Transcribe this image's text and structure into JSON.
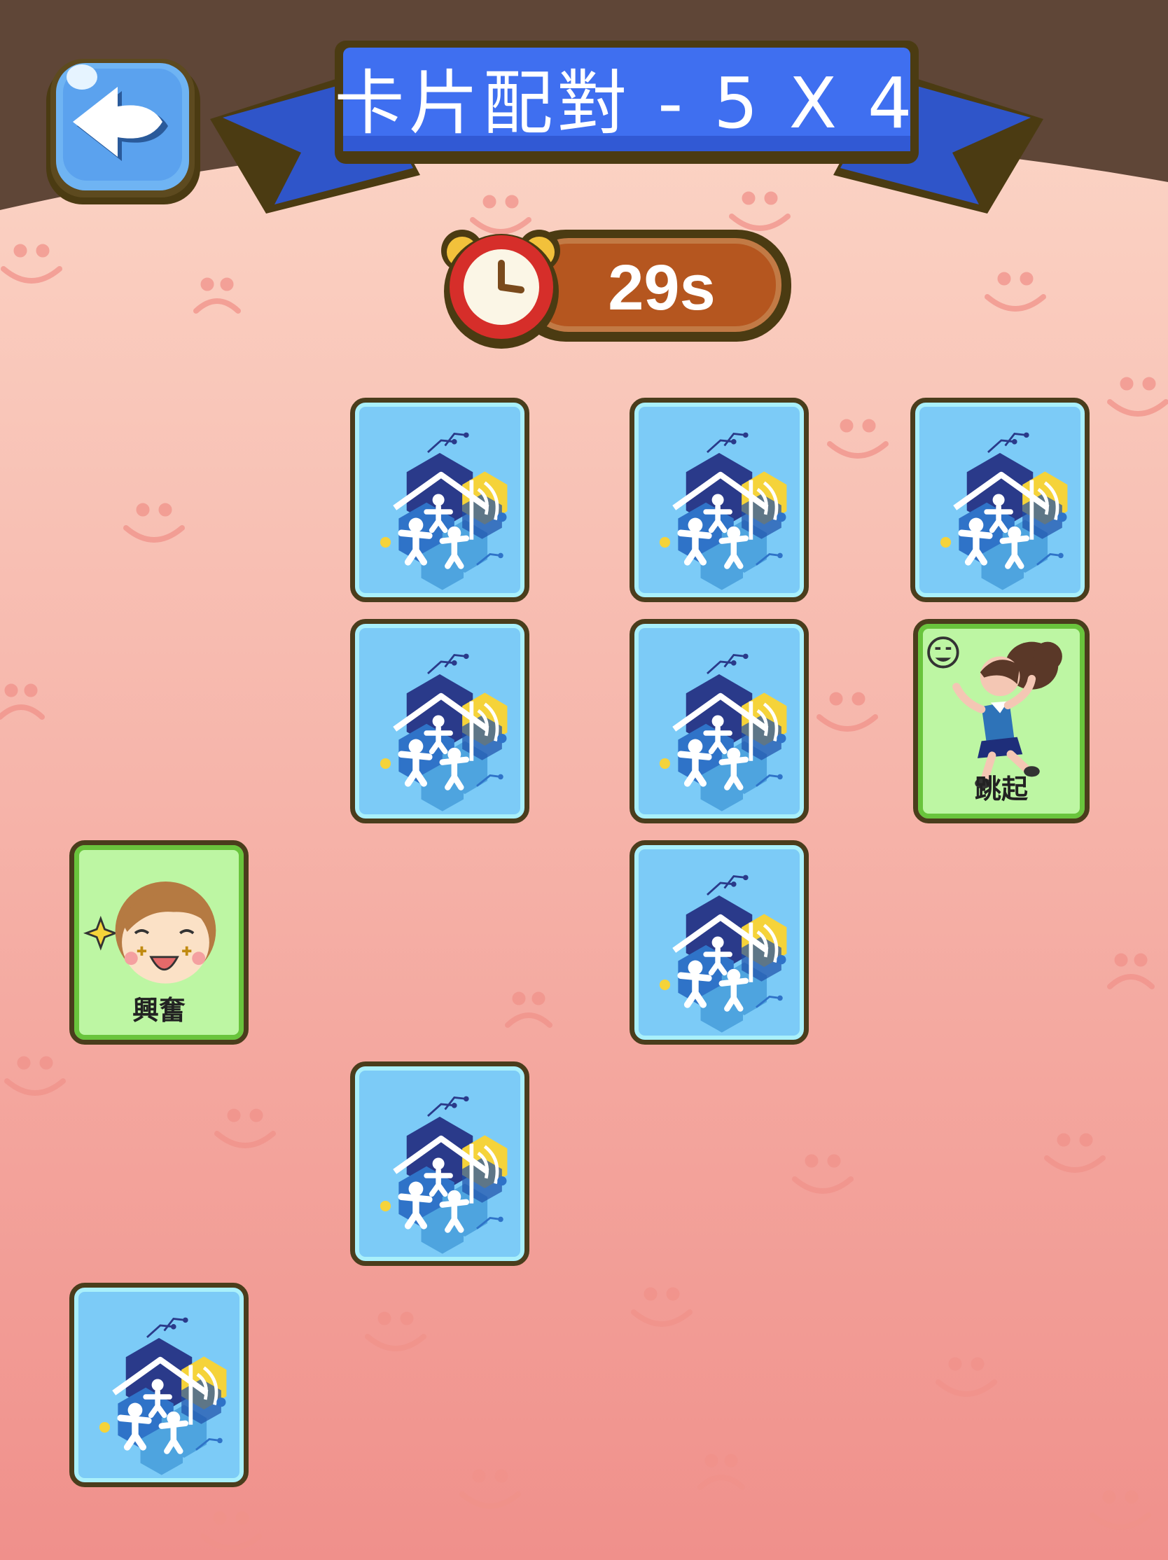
{
  "header": {
    "title": "卡片配對 - 5 X 4",
    "back_icon": "back-arrow-icon"
  },
  "timer": {
    "value": "29s",
    "icon": "alarm-clock-icon"
  },
  "board": {
    "grid": "5 X 4",
    "cards": [
      {
        "row": 1,
        "col": 2,
        "state": "face-down"
      },
      {
        "row": 1,
        "col": 3,
        "state": "face-down"
      },
      {
        "row": 1,
        "col": 4,
        "state": "face-down"
      },
      {
        "row": 2,
        "col": 2,
        "state": "face-down"
      },
      {
        "row": 2,
        "col": 3,
        "state": "face-down"
      },
      {
        "row": 2,
        "col": 4,
        "state": "face-up",
        "label": "跳起",
        "image": "girl-jumping"
      },
      {
        "row": 3,
        "col": 1,
        "state": "face-up",
        "label": "興奮",
        "image": "excited-boy-face"
      },
      {
        "row": 3,
        "col": 3,
        "state": "face-down"
      },
      {
        "row": 4,
        "col": 2,
        "state": "face-down"
      },
      {
        "row": 5,
        "col": 1,
        "state": "face-down"
      }
    ]
  },
  "colors": {
    "banner": "#3f6ff0",
    "card_back": "#7ccbf7",
    "card_face": "#bdf6a3",
    "timer_bar": "#b5561f",
    "background_top": "#fbd2c3",
    "background_bottom": "#f1908c"
  }
}
